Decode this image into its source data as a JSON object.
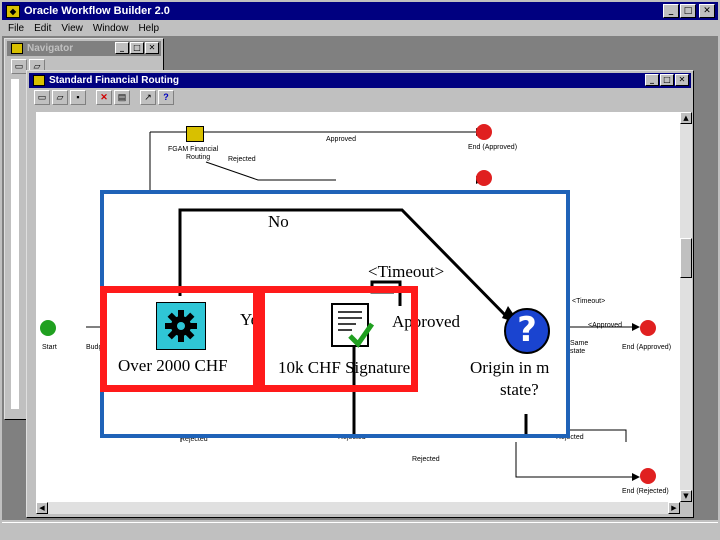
{
  "window": {
    "title": "Oracle Workflow Builder 2.0",
    "minimize": "_",
    "maximize": "□",
    "close": "✕"
  },
  "menu": [
    "File",
    "Edit",
    "View",
    "Window",
    "Help"
  ],
  "navigator": {
    "title": "Navigator"
  },
  "process_window": {
    "title": "Standard Financial Routing"
  },
  "background_nodes": {
    "approval_routing_1": "FGAM Financial",
    "approval_routing_2": "Routing",
    "end_approved_top": "End (Approved)",
    "start": "Start",
    "end_approved_right": "End (Approved)",
    "end_rejected": "End (Rejected)",
    "same_state_1": "Same",
    "same_state_2": "state"
  },
  "background_edges": {
    "approved_top": "Approved",
    "rejected_top": "Rejected",
    "budget": "Budg",
    "timeout_right": "<Timeout>",
    "approved_right": "<Approved",
    "rejected_1": "Rejected",
    "rejected_2": "Rejected",
    "rejected_3": "Rejected",
    "rejected_4": "Rejected"
  },
  "zoom": {
    "no": "No",
    "timeout": "<Timeout>",
    "yes": "Ye",
    "approved": "Approved",
    "over_2000": "Over 2000 CHF",
    "signature": "10k CHF Signature",
    "origin_line1": "Origin in m",
    "origin_line2": "state?"
  },
  "colors": {
    "title_active": "#000080",
    "frame_border": "#1f63b8",
    "highlight": "#ff1a1a",
    "gear_bg": "#2fc6d6"
  }
}
